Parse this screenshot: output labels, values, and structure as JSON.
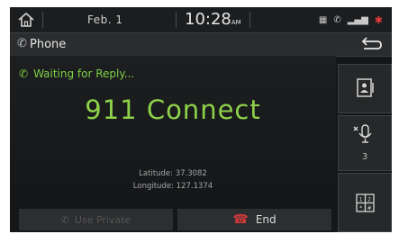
{
  "status": {
    "date": "Feb.  1",
    "time": "10:28",
    "ampm": "AM"
  },
  "header": {
    "title": "Phone"
  },
  "call": {
    "status": "Waiting for Reply...",
    "name": "911 Connect",
    "latitude": "Latitude: 37.3082",
    "longitude": "Longitude: 127.1374"
  },
  "buttons": {
    "use_private": "Use Private",
    "end": "End"
  },
  "side": {
    "mute_count": "3"
  },
  "colors": {
    "accent_green": "#8ed24a",
    "end_red": "#d23a3a"
  },
  "icons": [
    "home-icon",
    "phone-icon",
    "back-icon",
    "contacts-icon",
    "mute-mic-icon",
    "keypad-icon",
    "bluetooth-icon",
    "signal-icon",
    "battery-icon"
  ]
}
